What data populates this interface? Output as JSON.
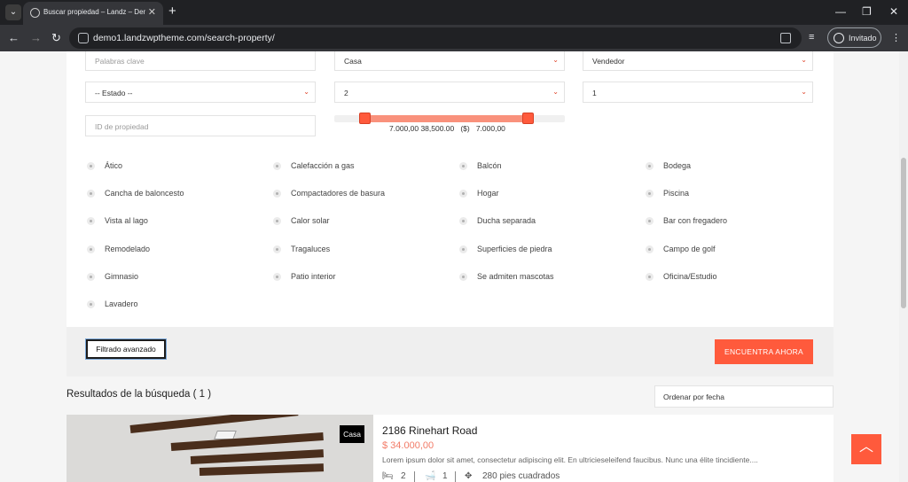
{
  "browser": {
    "tab_title": "Buscar propiedad – Landz – Dem",
    "url": "demo1.landzwptheme.com/search-property/",
    "profile_label": "Invitado"
  },
  "search": {
    "keywords_placeholder": "Palabras clave",
    "type_value": "Casa",
    "agent_value": "Vendedor",
    "state_value": "-- Estado --",
    "bedrooms_value": "2",
    "bathrooms_value": "1",
    "id_placeholder": "ID de propiedad",
    "price_range_text": "7.000,00 38,500.00   ($)   7.000,00",
    "price_range_fraction": [
      0.13,
      0.84
    ]
  },
  "amenities": [
    "Ático",
    "Calefacción a gas",
    "Balcón",
    "Bodega",
    "Cancha de baloncesto",
    "Compactadores de basura",
    "Hogar",
    "Piscina",
    "Vista al lago",
    "Calor solar",
    "Ducha separada",
    "Bar con fregadero",
    "Remodelado",
    "Tragaluces",
    "Superficies de piedra",
    "Campo de golf",
    "Gimnasio",
    "Patio interior",
    "Se admiten mascotas",
    "Oficina/Estudio",
    "Lavadero"
  ],
  "actions": {
    "advanced_label": "Filtrado avanzado",
    "find_label": "ENCUENTRA AHORA"
  },
  "results": {
    "title": "Resultados de la búsqueda ( 1 )",
    "sort_value": "Ordenar por fecha"
  },
  "listing": {
    "badge": "Casa",
    "title": "2186 Rinehart Road",
    "price": "$ 34.000,00",
    "description": "Lorem ipsum dolor sit amet, consectetur adipiscing elit. En ultricieseleifend faucibus. Nunc una élite tincidiente....",
    "bedrooms": "2",
    "bathrooms": "1",
    "area": "280 pies cuadrados"
  },
  "colors": {
    "accent": "#ff5a3c",
    "price": "#f27b67",
    "browser_chrome": "#202124"
  }
}
